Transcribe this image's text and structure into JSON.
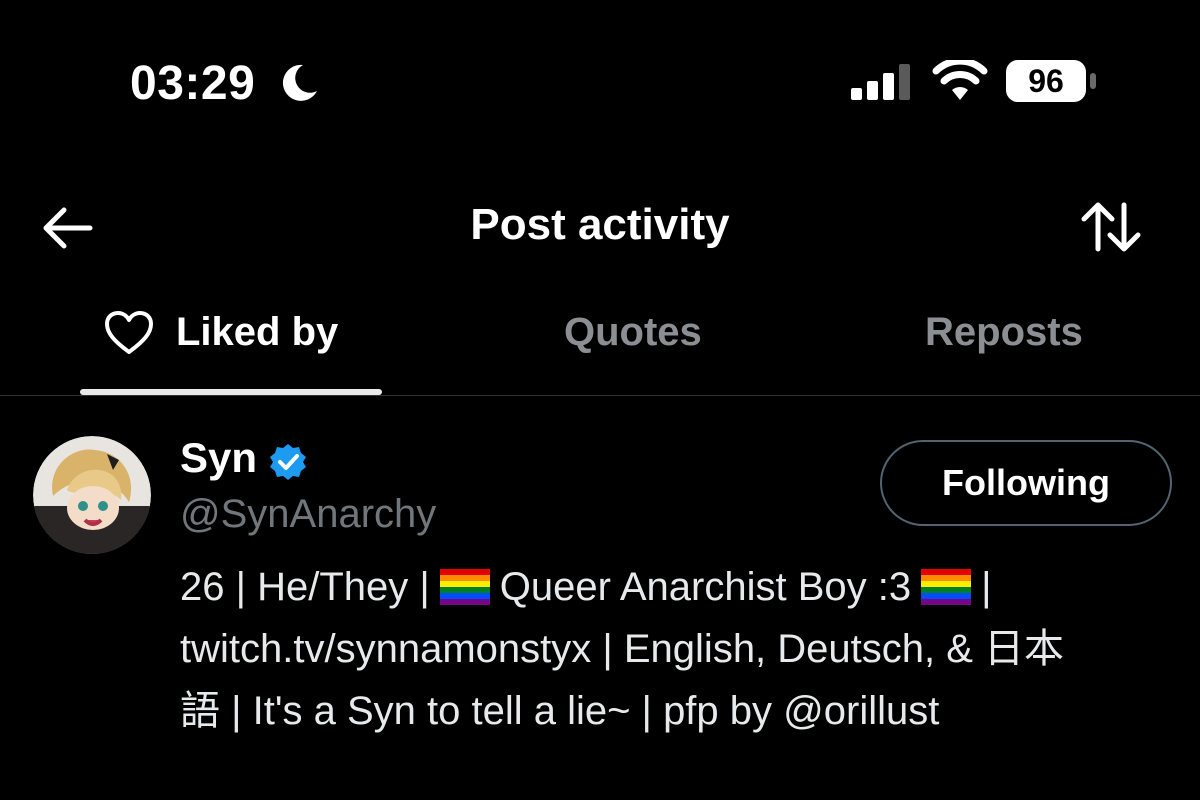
{
  "status_bar": {
    "time": "03:29",
    "battery": "96",
    "moon_icon": "moon-icon",
    "signal_icon": "cellular-signal-icon",
    "wifi_icon": "wifi-icon"
  },
  "header": {
    "title": "Post activity",
    "back_icon": "back-arrow-icon",
    "sort_icon": "sort-arrows-icon"
  },
  "tabs": [
    {
      "label": "Liked by",
      "icon": "heart-icon",
      "active": true
    },
    {
      "label": "Quotes",
      "active": false
    },
    {
      "label": "Reposts",
      "active": false
    }
  ],
  "colors": {
    "background": "#000000",
    "text_primary": "#ffffff",
    "text_secondary": "#71767b",
    "verified_blue": "#1d9bf0",
    "divider": "#2f3336"
  },
  "user": {
    "name": "Syn",
    "handle": "@SynAnarchy",
    "verified": true,
    "follow_button": "Following",
    "bio": {
      "line1_a": "26 | He/They |",
      "line1_b": "Queer Anarchist Boy :3",
      "line1_c": "|",
      "line2": "twitch.tv/synnamonstyx | English, Deutsch, & 日本",
      "line3": "語 | It's a Syn to tell a lie~ | pfp by @orillust"
    }
  }
}
